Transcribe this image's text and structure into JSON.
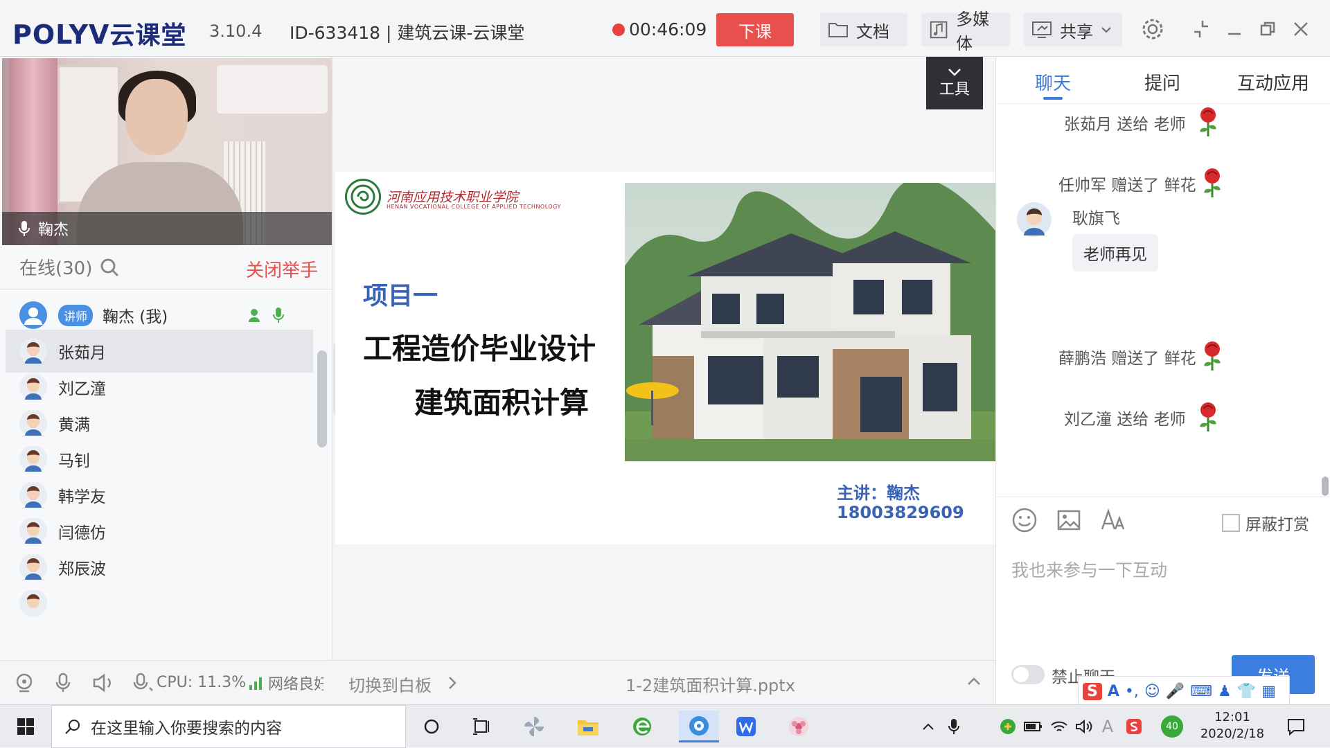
{
  "titlebar": {
    "logo_text": "POLYV",
    "logo_cn": "云课堂",
    "version": "3.10.4",
    "room_id": "ID-633418 | 建筑云课-云课堂",
    "timer": "00:46:09",
    "end_class_label": "下课",
    "doc_label": "文档",
    "media_label": "多媒体",
    "share_label": "共享"
  },
  "video": {
    "presenter_name": "鞠杰"
  },
  "online": {
    "label": "在线(30)",
    "close_hand_label": "关闭举手"
  },
  "users": [
    {
      "name": "鞠杰 (我)",
      "badge": "讲师"
    },
    {
      "name": "张茹月"
    },
    {
      "name": "刘乙潼"
    },
    {
      "name": "黄满"
    },
    {
      "name": "马钊"
    },
    {
      "name": "韩学友"
    },
    {
      "name": "闫德仿"
    },
    {
      "name": "郑辰波"
    }
  ],
  "leftfoot": {
    "cpu": "CPU: 11.3%",
    "network": "网络良好"
  },
  "center": {
    "tools_label": "工具",
    "switch_whiteboard": "切换到白板",
    "filename": "1-2建筑面积计算.pptx"
  },
  "slide": {
    "college_name": "河南应用技术职业学院",
    "college_en": "HENAN VOCATIONAL COLLEGE OF APPLIED TECHNOLOGY",
    "project": "项目一",
    "title_line1": "工程造价毕业设计",
    "title_line2": "建筑面积计算",
    "lecturer": "主讲：鞠杰",
    "phone": "18003829609"
  },
  "right": {
    "tabs": [
      "聊天",
      "提问",
      "互动应用"
    ],
    "messages": [
      {
        "type": "gift",
        "text": "张茹月 送给 老师"
      },
      {
        "type": "gift",
        "text": "任帅军 赠送了 鲜花"
      },
      {
        "type": "chat",
        "sender": "耿旗飞",
        "text": "老师再见"
      },
      {
        "type": "gift",
        "text": "薛鹏浩 赠送了 鲜花"
      },
      {
        "type": "gift",
        "text": "刘乙潼 送给 老师"
      }
    ],
    "block_reward_label": "屏蔽打赏",
    "input_placeholder": "我也来参与一下互动",
    "forbid_chat_label": "禁止聊天",
    "send_label": "发送"
  },
  "taskbar": {
    "search_placeholder": "在这里输入你要搜索的内容",
    "time": "12:01",
    "date": "2020/2/18",
    "badge_count": "40"
  },
  "colors": {
    "accent": "#3b7ee0",
    "end_button": "#e8504d",
    "logo": "#1d2c78"
  }
}
